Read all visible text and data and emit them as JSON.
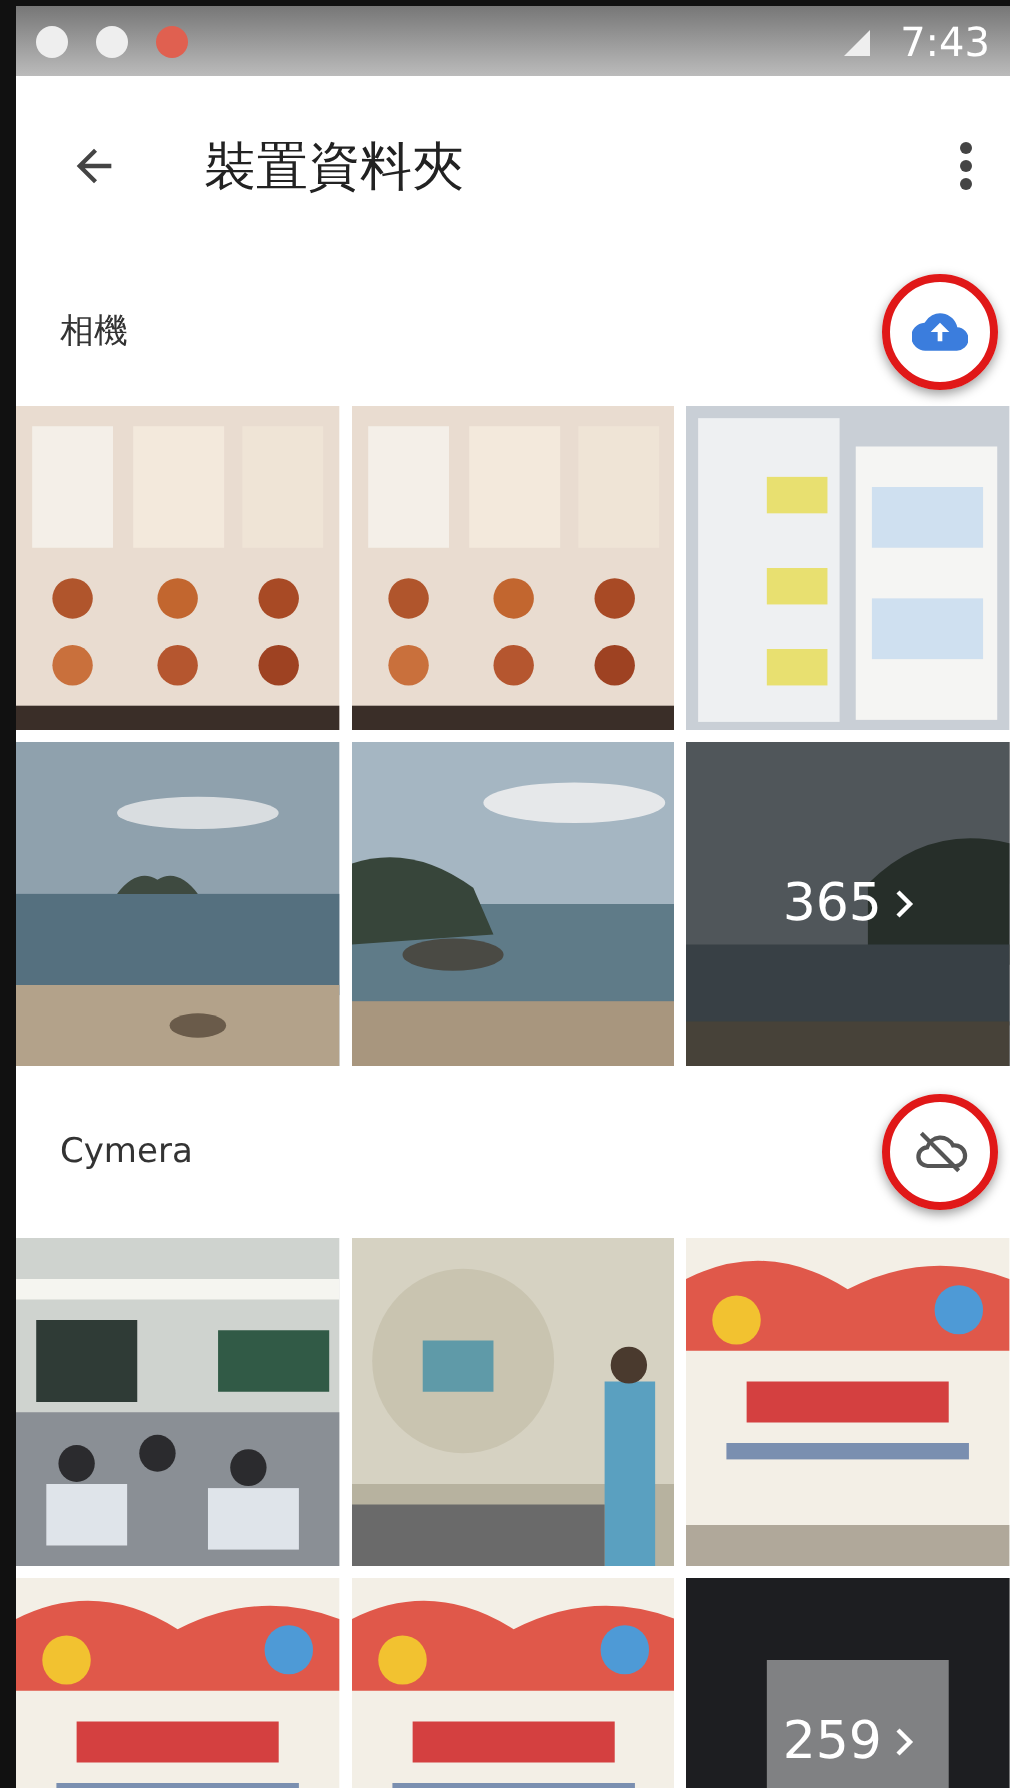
{
  "status_bar": {
    "time": "7:43"
  },
  "app_bar": {
    "title": "裝置資料夾"
  },
  "sections": [
    {
      "title": "相機",
      "backed_up": true,
      "highlighted": true,
      "count": "365"
    },
    {
      "title": "Cymera",
      "backed_up": false,
      "highlighted": true,
      "count": "259"
    }
  ]
}
